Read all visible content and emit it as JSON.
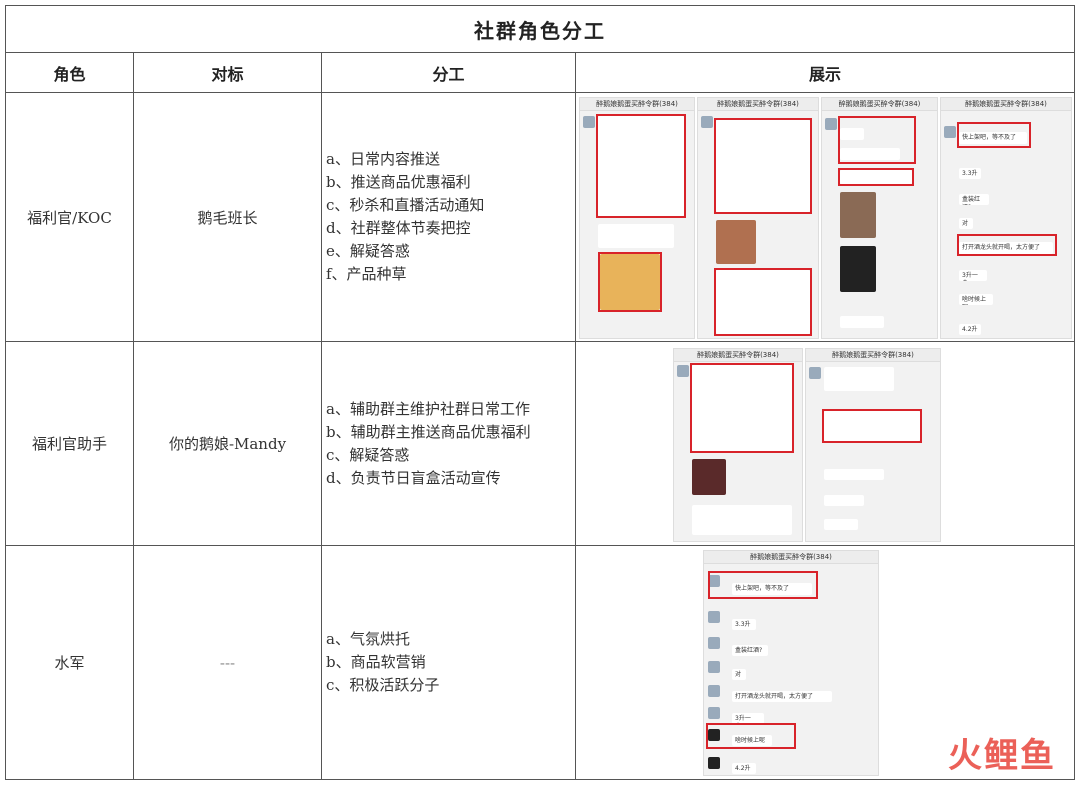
{
  "title": "社群角色分工",
  "headers": {
    "role": "角色",
    "benchmark": "对标",
    "duties": "分工",
    "display": "展示"
  },
  "rows": [
    {
      "role": "福利官/KOC",
      "benchmark": "鹅毛班长",
      "duties": [
        "a、日常内容推送",
        "b、推送商品优惠福利",
        "c、秒杀和直播活动通知",
        "d、社群整体节奏把控",
        "e、解疑答惑",
        "f、产品种草"
      ]
    },
    {
      "role": "福利官助手",
      "benchmark": "你的鹅娘-Mandy",
      "duties": [
        "a、辅助群主维护社群日常工作",
        "b、辅助群主推送商品优惠福利",
        "c、解疑答惑",
        "d、负责节日盲盒活动宣传"
      ]
    },
    {
      "role": "水军",
      "benchmark": "---",
      "duties": [
        "a、气氛烘托",
        "b、商品软营销",
        "c、积极活跃分子"
      ]
    }
  ],
  "screenshots": {
    "group_name": "醉鹅娘鹅蛋买醉令群(384)",
    "msg_fast": "快上架吧，等不及了",
    "msg_33": "3.3升",
    "msg_box": "盒装红酒?",
    "msg_dui": "对",
    "msg_open": "打开酒龙头就开喝，太方便了",
    "msg_3l": "3升一盒。",
    "msg_hang": "啥时候上呢",
    "msg_42": "4.2升"
  },
  "watermark": "火鲤鱼",
  "colors": {
    "highlight": "#d8232a",
    "watermark": "#e8453c",
    "border": "#555555"
  }
}
